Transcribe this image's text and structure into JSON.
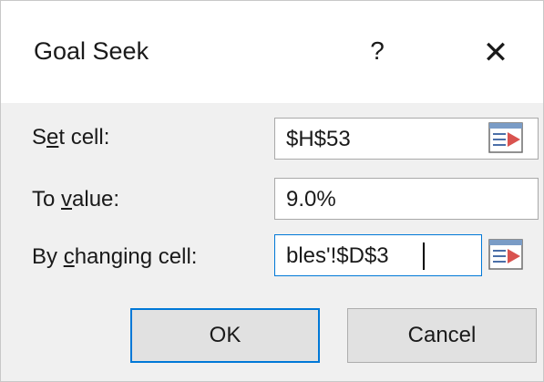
{
  "dialog": {
    "title": "Goal Seek",
    "help_label": "?",
    "close_label": "✕"
  },
  "form": {
    "set_cell": {
      "label_pre": "S",
      "label_accel": "e",
      "label_post": "t cell:",
      "value": "$H$53"
    },
    "to_value": {
      "label_pre": "To ",
      "label_accel": "v",
      "label_post": "alue:",
      "value": "9.0%"
    },
    "by_changing": {
      "label_pre": "By ",
      "label_accel": "c",
      "label_post": "hanging cell:",
      "value": "bles'!$D$3"
    }
  },
  "buttons": {
    "ok_label": "OK",
    "cancel_label": "Cancel"
  },
  "icons": {
    "ref_button_icon": "collapse-dialog-icon"
  },
  "colors": {
    "focus_border": "#0078d7",
    "ref_icon_accent": "#d9534f"
  }
}
